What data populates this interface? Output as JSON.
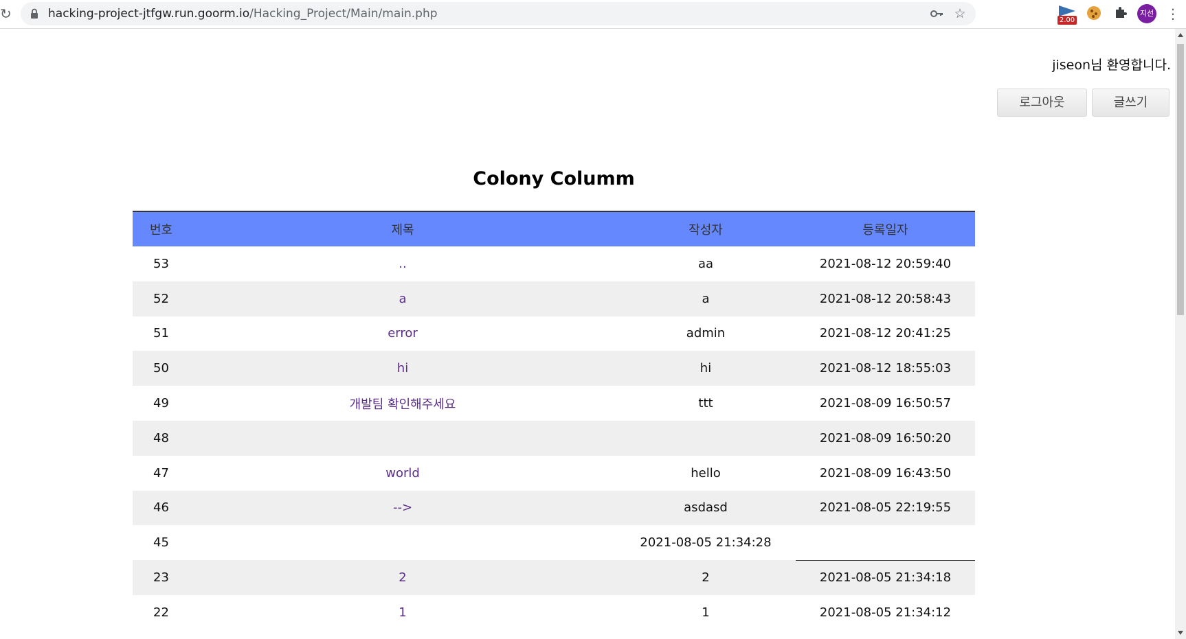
{
  "browser": {
    "url_host": "hacking-project-jtfgw.run.goorm.io",
    "url_path": "/Hacking_Project/Main/main.php",
    "extension_badge": "2.00",
    "profile_initials": "지선"
  },
  "header": {
    "welcome_text": "jiseon님 환영합니다.",
    "logout_label": "로그아웃",
    "write_label": "글쓰기"
  },
  "board": {
    "title": "Colony Columm",
    "columns": [
      "번호",
      "제목",
      "작성자",
      "등록일자"
    ],
    "rows": [
      {
        "no": "53",
        "title": "..",
        "author": "aa",
        "date": "2021-08-12 20:59:40"
      },
      {
        "no": "52",
        "title": "a",
        "author": "a",
        "date": "2021-08-12 20:58:43"
      },
      {
        "no": "51",
        "title": "error",
        "author": "admin",
        "date": "2021-08-12 20:41:25"
      },
      {
        "no": "50",
        "title": "hi",
        "author": "hi",
        "date": "2021-08-12 18:55:03"
      },
      {
        "no": "49",
        "title": "개발팀 확인해주세요",
        "author": "ttt",
        "date": "2021-08-09 16:50:57"
      },
      {
        "no": "48",
        "title": "",
        "author": "",
        "date": "2021-08-09 16:50:20"
      },
      {
        "no": "47",
        "title": "world",
        "author": "hello",
        "date": "2021-08-09 16:43:50"
      },
      {
        "no": "46",
        "title": "-->",
        "author": "asdasd",
        "date": "2021-08-05 22:19:55"
      },
      {
        "no": "45",
        "title": "",
        "author": "2021-08-05 21:34:28",
        "date": ""
      },
      {
        "no": "23",
        "title": "2",
        "author": "2",
        "date": "2021-08-05 21:34:18"
      },
      {
        "no": "22",
        "title": "1",
        "author": "1",
        "date": "2021-08-05 21:34:12"
      }
    ]
  }
}
